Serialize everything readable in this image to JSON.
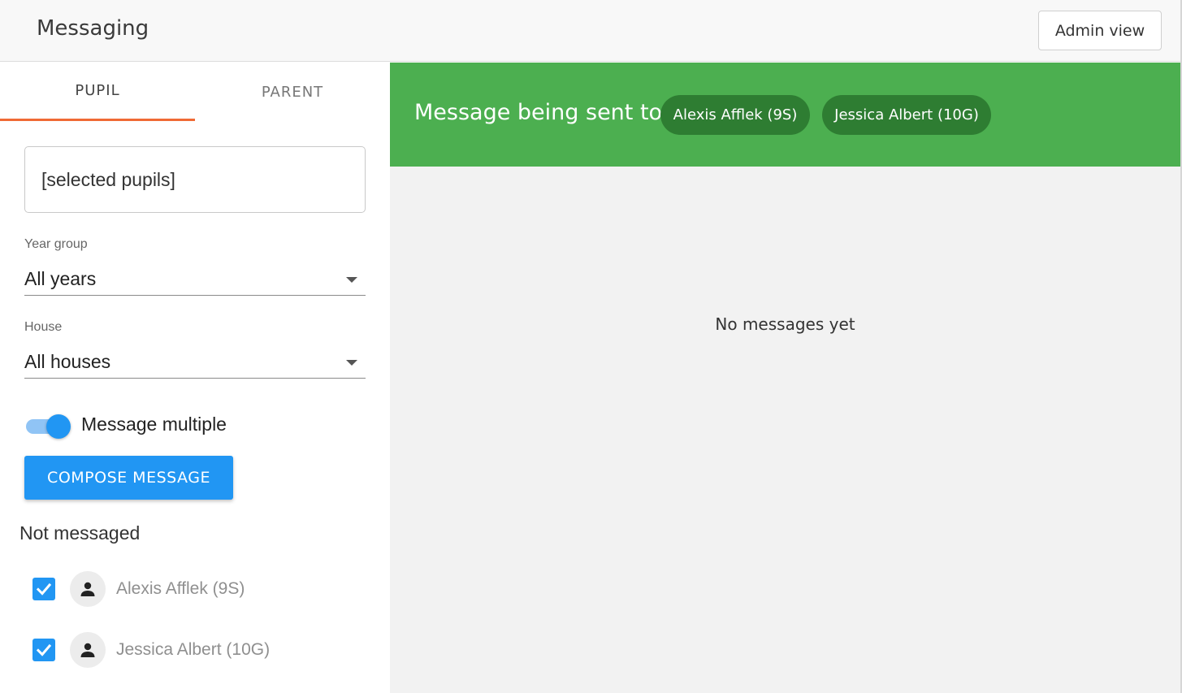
{
  "header": {
    "title": "Messaging",
    "admin_button": "Admin view"
  },
  "sidebar": {
    "tabs": [
      {
        "label": "PUPIL",
        "active": true
      },
      {
        "label": "PARENT",
        "active": false
      }
    ],
    "search_value": "[selected pupils]",
    "year_group": {
      "label": "Year group",
      "value": "All years"
    },
    "house": {
      "label": "House",
      "value": "All houses"
    },
    "toggle": {
      "label": "Message multiple",
      "on": true
    },
    "compose_button": "COMPOSE MESSAGE",
    "not_messaged_title": "Not messaged",
    "pupils": [
      {
        "name": "Alexis Afflek (9S)",
        "checked": true
      },
      {
        "name": "Jessica Albert (10G)",
        "checked": true
      }
    ]
  },
  "main": {
    "banner_label": "Message being sent to:",
    "recipients": [
      "Alexis Afflek (9S)",
      "Jessica Albert (10G)"
    ],
    "empty_text": "No messages yet"
  },
  "colors": {
    "accent_blue": "#2196f3",
    "banner_green": "#4caf50",
    "chip_green": "#2e7d32",
    "tab_underline": "#f06a35"
  },
  "icons": {
    "checkbox": "check-icon",
    "avatar": "person-icon",
    "select_caret": "caret-down-icon"
  }
}
